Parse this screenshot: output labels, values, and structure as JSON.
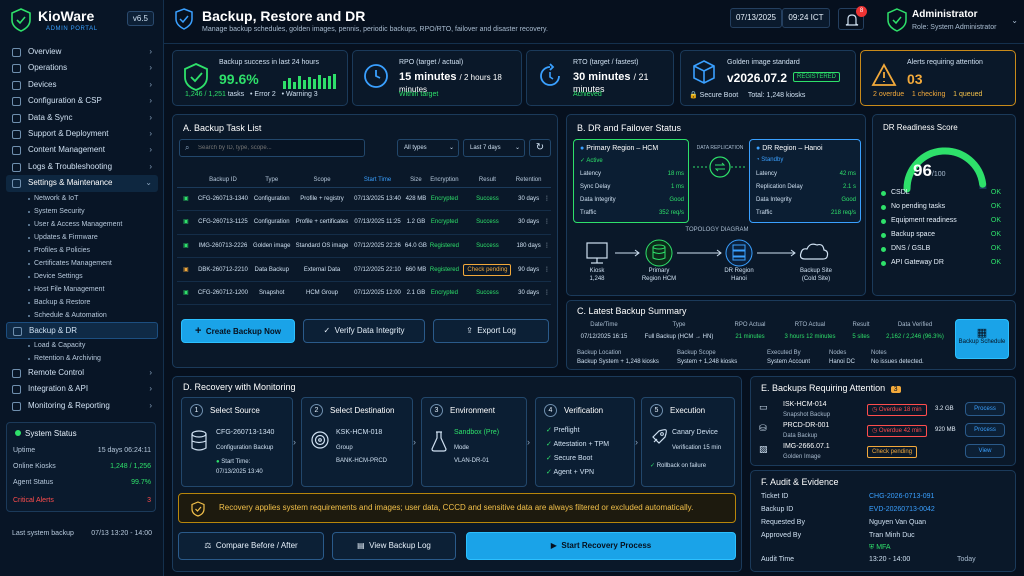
{
  "brand": {
    "name": "KioWare",
    "sub": "ADMIN PORTAL",
    "version": "v6.5"
  },
  "nav": {
    "overview": "Overview",
    "operations": "Operations",
    "devices": "Devices",
    "config": "Configuration & CSP",
    "data_sync": "Data & Sync",
    "support": "Support & Deployment",
    "content": "Content Management",
    "logs": "Logs & Troubleshooting",
    "settings": "Settings & Maintenance",
    "settings_sub": [
      "Network & IoT",
      "System Security",
      "User & Access Management",
      "Updates & Firmware",
      "Profiles & Policies",
      "Certificates Management",
      "Device Settings",
      "Host File Management",
      "Backup & Restore",
      "Schedule & Automation"
    ],
    "backup_dr": "Backup & DR",
    "backup_sub": [
      "Load & Capacity",
      "Retention & Archiving"
    ],
    "remote": "Remote Control",
    "integration": "Integration & API",
    "monitoring": "Monitoring & Reporting"
  },
  "system_status": {
    "title": "System Status",
    "uptime_label": "Uptime",
    "uptime": "15 days 06:24:11",
    "kiosks_label": "Online Kiosks",
    "kiosks": "1,248 / 1,256",
    "agent_label": "Agent Status",
    "agent": "99.7%",
    "alerts_label": "Critical Alerts",
    "alerts": "3"
  },
  "last_backup": {
    "label": "Last system backup",
    "value": "07/13 13:20 - 14:00"
  },
  "header": {
    "title": "Backup, Restore and DR",
    "desc": "Manage backup schedules, golden images, pennis, periodic backups, RPO/RTO, failover and disaster recovery.",
    "date": "07/13/2025",
    "time": "09:24 ICT",
    "notif": "8",
    "user": "Administrator",
    "role": "Role: System Administrator"
  },
  "kpi": [
    {
      "title": "Backup success in last 24 hours",
      "value": "99.6%",
      "sub1": "1,246 / 1,251",
      "sub2": "tasks",
      "sub3": "Error 2",
      "sub4": "Warning 3"
    },
    {
      "title": "RPO (target / actual)",
      "value": "15 minutes",
      "value2": "/ 2 hours 18 minutes",
      "sub": "Within target"
    },
    {
      "title": "RTO (target / fastest)",
      "value": "30 minutes",
      "value2": "/ 21 minutes",
      "sub": "Achieved"
    },
    {
      "title": "Golden image standard",
      "value": "v2026.07.2",
      "tag": "REGISTERED",
      "sub1": "Secure Boot",
      "sub2": "Total: 1,248 kiosks"
    },
    {
      "title": "Alerts requiring attention",
      "value": "03",
      "sub1": "2 overdue",
      "sub2": "1 checking",
      "sub3": "1 queued"
    }
  ],
  "tasks": {
    "title": "A. Backup Task List",
    "search_placeholder": "Search by ID, type, scope...",
    "filter_type": "All types",
    "filter_range": "Last 7 days",
    "columns": [
      "Backup ID",
      "Type",
      "Scope",
      "Start Time",
      "Size",
      "Encryption",
      "Result",
      "Retention"
    ],
    "rows": [
      {
        "id": "CFG-260713-1340",
        "type": "Configuration",
        "scope": "Profile + registry",
        "start": "07/13/2025 13:40",
        "size": "428 MB",
        "enc": "Encrypted",
        "result": "Success",
        "ret": "30 days"
      },
      {
        "id": "CFG-260713-1125",
        "type": "Configuration",
        "scope": "Profile + certificates",
        "start": "07/13/2025 11:25",
        "size": "1.2 GB",
        "enc": "Encrypted",
        "result": "Success",
        "ret": "30 days"
      },
      {
        "id": "IMG-260713-2226",
        "type": "Golden image",
        "scope": "Standard OS image",
        "start": "07/12/2025 22:26",
        "size": "64.0 GB",
        "enc": "Registered",
        "result": "Success",
        "ret": "180 days"
      },
      {
        "id": "DBK-260712-2210",
        "type": "Data Backup",
        "scope": "External Data",
        "start": "07/12/2025 22:10",
        "size": "660 MB",
        "enc": "Registered",
        "result": "Check pending",
        "ret": "90 days"
      },
      {
        "id": "CFG-260712-1200",
        "type": "Snapshot",
        "scope": "HCM Group",
        "start": "07/12/2025 12:00",
        "size": "2.1 GB",
        "enc": "Encrypted",
        "result": "Success",
        "ret": "30 days"
      }
    ],
    "btn_create": "Create Backup Now",
    "btn_verify": "Verify Data Integrity",
    "btn_export": "Export Log"
  },
  "dr": {
    "title": "B. DR and Failover Status",
    "primary": {
      "name": "Primary Region – HCM",
      "state": "Active",
      "rows": [
        [
          "Latency",
          "18 ms"
        ],
        [
          "Sync Delay",
          "1 ms"
        ],
        [
          "Data Integrity",
          "Good"
        ],
        [
          "Traffic",
          "352 req/s"
        ]
      ]
    },
    "replication": "DATA REPLICATION",
    "secondary": {
      "name": "DR Region – Hanoi",
      "state": "Standby",
      "rows": [
        [
          "Latency",
          "42 ms"
        ],
        [
          "Replication Delay",
          "2.1 s"
        ],
        [
          "Data Integrity",
          "Good"
        ],
        [
          "Traffic",
          "218 req/s"
        ]
      ]
    },
    "topology": "TOPOLOGY DIAGRAM",
    "nodes": [
      {
        "l1": "Kiosk",
        "l2": "1,248"
      },
      {
        "l1": "Primary",
        "l2": "Region HCM"
      },
      {
        "l1": "DR Region",
        "l2": "Hanoi"
      },
      {
        "l1": "Backup Site",
        "l2": "(Cold Site)"
      }
    ]
  },
  "readiness": {
    "title": "DR Readiness Score",
    "score": 96,
    "max": "/100",
    "items": [
      [
        "CSDL",
        "OK"
      ],
      [
        "No pending tasks",
        "OK"
      ],
      [
        "Equipment readiness",
        "OK"
      ],
      [
        "Backup space",
        "OK"
      ],
      [
        "DNS / GSLB",
        "OK"
      ],
      [
        "API Gateway DR",
        "OK"
      ]
    ]
  },
  "summary": {
    "title": "C. Latest Backup Summary",
    "h": [
      "Date/Time",
      "Type",
      "RPO Actual",
      "RTO Actual",
      "Result",
      "Data Verified"
    ],
    "v": [
      "07/12/2025 16:15",
      "Full Backup (HCM → HN)",
      "21 minutes",
      "3 hours 12 minutes",
      "5 sites",
      "2,162 / 2,246 (96.3%)"
    ],
    "h2": [
      "Backup Location",
      "Backup Scope",
      "Executed By",
      "Nodes",
      "Notes"
    ],
    "v2": [
      "Backup System + 1,248 kiosks",
      "System + 1,248 kiosks",
      "System Account",
      "Hanoi DC",
      "No issues detected."
    ],
    "btn": "Backup Schedule"
  },
  "recovery": {
    "title": "D. Recovery with Monitoring",
    "steps": [
      {
        "n": "1",
        "t": "Select Source",
        "l": [
          "CFG-260713-1340",
          "Configuration Backup",
          "Start Time:",
          "07/13/2025 13:40"
        ]
      },
      {
        "n": "2",
        "t": "Select Destination",
        "l": [
          "KSK-HCM-018",
          "Group",
          "BANK-HCM-PRCD"
        ]
      },
      {
        "n": "3",
        "t": "Environment",
        "l": [
          "Sandbox (Pre)",
          "Mode",
          "VLAN-DR-01"
        ]
      },
      {
        "n": "4",
        "t": "Verification",
        "l": [
          "Preflight",
          "Attestation + TPM",
          "Secure Boot",
          "Agent + VPN"
        ]
      },
      {
        "n": "5",
        "t": "Execution",
        "l": [
          "Canary Device",
          "Verification 15 min",
          "Rollback on failure"
        ]
      }
    ],
    "warning": "Recovery applies system requirements and images; user data, CCCD and sensitive data are always filtered or excluded automatically.",
    "btn_compare": "Compare Before / After",
    "btn_log": "View Backup Log",
    "btn_start": "Start Recovery Process"
  },
  "attention": {
    "title": "E. Backups Requiring Attention",
    "count": "3",
    "rows": [
      {
        "id": "ISK-HCM-014",
        "sub": "Snapshot Backup",
        "status": "Overdue 18 min",
        "size": "3.2 GB",
        "btn": "Process"
      },
      {
        "id": "PRCD-DR-001",
        "sub": "Data Backup",
        "status": "Overdue 42 min",
        "size": "920 MB",
        "btn": "Process"
      },
      {
        "id": "IMG-2666.07.1",
        "sub": "Golden Image",
        "status": "Check pending",
        "size": "",
        "btn": "View"
      }
    ]
  },
  "audit": {
    "title": "F. Audit & Evidence",
    "rows": [
      [
        "Ticket ID",
        "CHG-2026-0713-091"
      ],
      [
        "Backup ID",
        "EVD-20260713-0042"
      ],
      [
        "Requested By",
        "Nguyen Van Quan"
      ],
      [
        "Approved By",
        "Tran Minh Duc"
      ],
      [
        "",
        "MFA"
      ],
      [
        "Audit Time",
        "13:20 - 14:00"
      ]
    ],
    "today": "Today"
  },
  "colors": {
    "accent": "#1aa3e8",
    "ok": "#2ee06a",
    "warn": "#f2a93b",
    "danger": "#ff4d4d"
  }
}
